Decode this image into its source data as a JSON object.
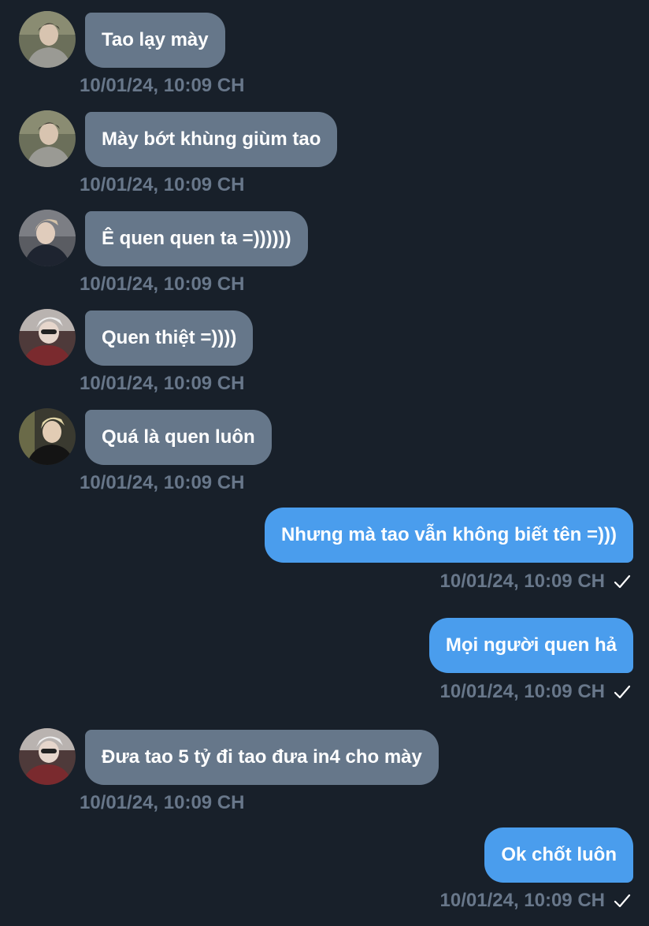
{
  "colors": {
    "background": "#18202a",
    "incoming_bubble": "#66778a",
    "outgoing_bubble": "#4a9ded",
    "timestamp": "#68778a"
  },
  "messages": [
    {
      "direction": "incoming",
      "avatar": "avatar-person-1",
      "text": "Tao lạy mày",
      "time": "10/01/24, 10:09 CH"
    },
    {
      "direction": "incoming",
      "avatar": "avatar-person-1",
      "text": "Mày bớt khùng giùm tao",
      "time": "10/01/24, 10:09 CH"
    },
    {
      "direction": "incoming",
      "avatar": "avatar-person-2",
      "text": "Ê quen quen ta =))))))",
      "time": "10/01/24, 10:09 CH"
    },
    {
      "direction": "incoming",
      "avatar": "avatar-person-3",
      "text": "Quen thiệt =))))",
      "time": "10/01/24, 10:09 CH"
    },
    {
      "direction": "incoming",
      "avatar": "avatar-person-4",
      "text": "Quá là quen luôn",
      "time": "10/01/24, 10:09 CH"
    },
    {
      "direction": "outgoing",
      "text": "Nhưng mà tao vẫn không biết tên =)))",
      "time": "10/01/24, 10:09 CH",
      "status_icon": "check-icon"
    },
    {
      "direction": "outgoing",
      "text": "Mọi người quen hả",
      "time": "10/01/24, 10:09 CH",
      "status_icon": "check-icon"
    },
    {
      "direction": "incoming",
      "avatar": "avatar-person-3",
      "text": "Đưa tao 5 tỷ đi tao đưa in4 cho mày",
      "time": "10/01/24, 10:09 CH"
    },
    {
      "direction": "outgoing",
      "text": "Ok chốt luôn",
      "time": "10/01/24, 10:09 CH",
      "status_icon": "check-icon"
    }
  ]
}
